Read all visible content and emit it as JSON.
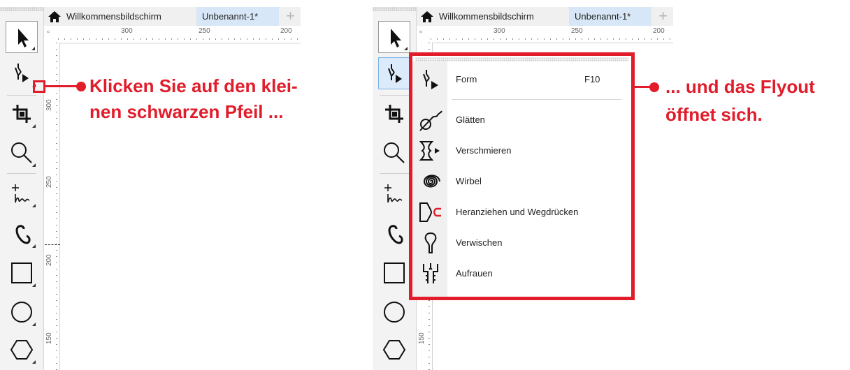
{
  "tabs": {
    "home_icon": "house-icon",
    "welcome": "Willkommensbildschirm",
    "document": "Unbenannt-1*",
    "add": "+"
  },
  "ruler": {
    "top_labels": [
      "300",
      "250",
      "200"
    ],
    "left_labels": [
      "300",
      "250",
      "200",
      "150"
    ]
  },
  "toolbox": {
    "tools": [
      "pick-tool",
      "shape-tool",
      "crop-tool",
      "zoom-tool",
      "freehand-tool",
      "artistic-media-tool",
      "rectangle-tool",
      "ellipse-tool",
      "polygon-tool"
    ]
  },
  "callouts": {
    "left_line1": "Klicken Sie auf den klei-",
    "left_line2": "nen schwarzen Pfeil ...",
    "right_line1": "... und das Flyout",
    "right_line2": "öffnet sich.",
    "color": "#e11d2b"
  },
  "flyout": {
    "items": [
      {
        "label": "Form",
        "shortcut": "F10",
        "icon": "shape-tool-icon"
      },
      {
        "label": "Glätten",
        "icon": "smooth-tool-icon"
      },
      {
        "label": "Verschmieren",
        "icon": "smear-tool-icon"
      },
      {
        "label": "Wirbel",
        "icon": "twirl-tool-icon"
      },
      {
        "label": "Heranziehen und Wegdrücken",
        "icon": "attract-repel-tool-icon"
      },
      {
        "label": "Verwischen",
        "icon": "smudge-tool-icon"
      },
      {
        "label": "Aufrauen",
        "icon": "roughen-tool-icon"
      }
    ]
  }
}
